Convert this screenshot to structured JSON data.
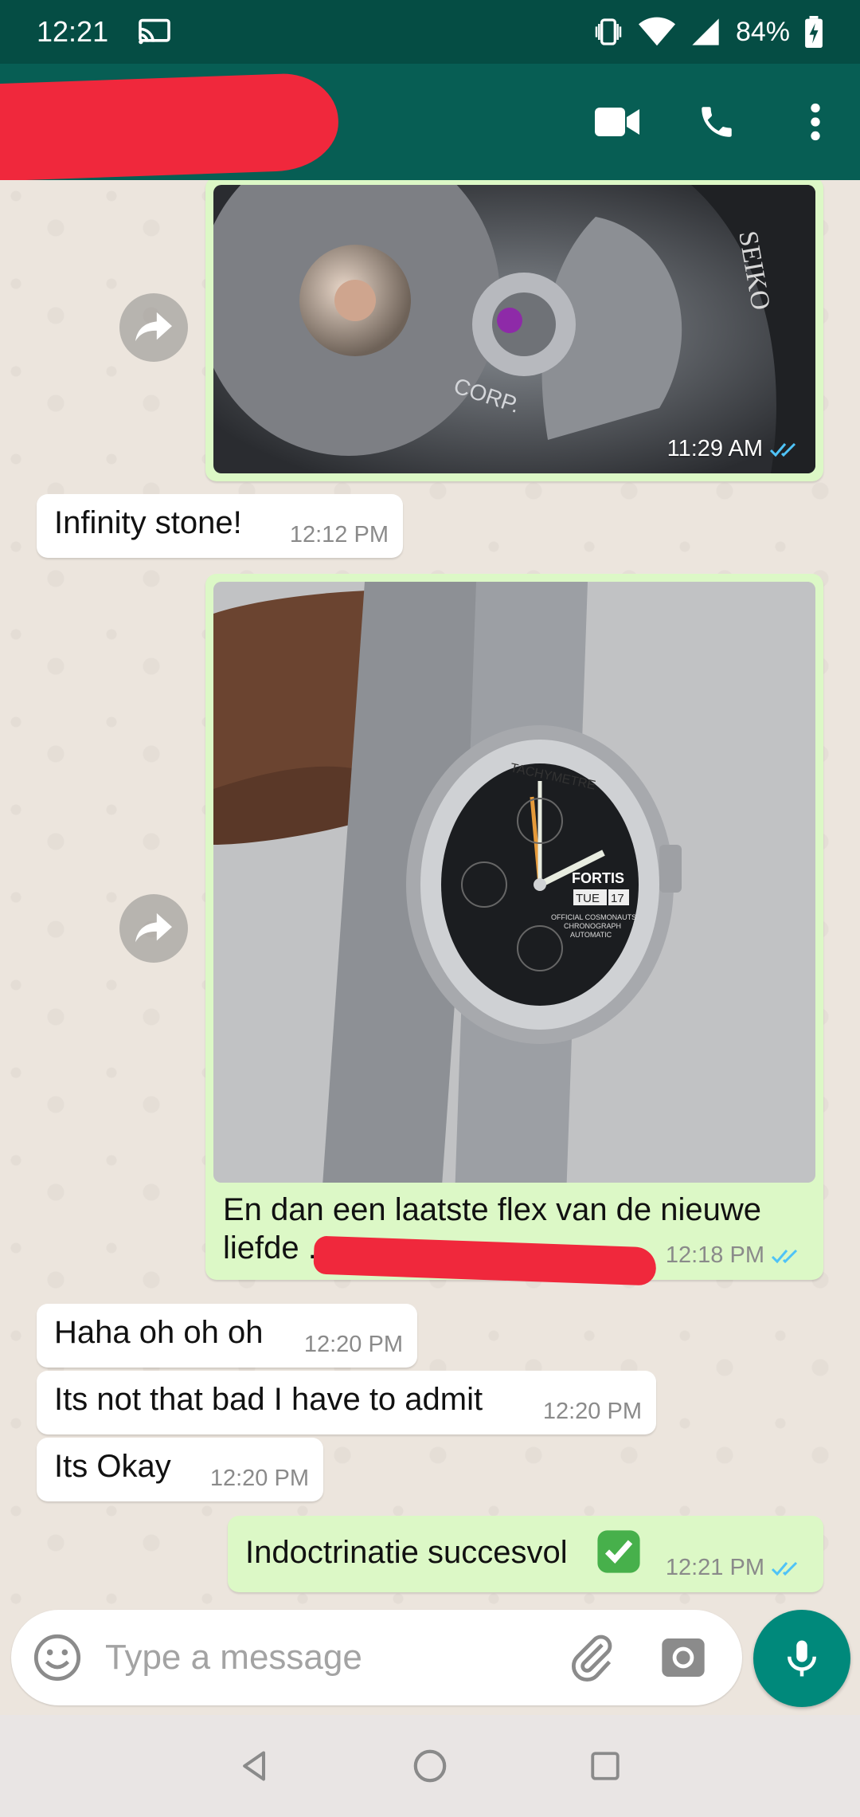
{
  "status_bar": {
    "time": "12:21",
    "battery": "84%"
  },
  "app_bar": {
    "contact_name_redacted": true
  },
  "messages": [
    {
      "type": "image",
      "direction": "out",
      "image_desc": "watch-movement-photo",
      "time": "11:29 AM",
      "status": "read"
    },
    {
      "type": "text",
      "direction": "in",
      "text": "Infinity stone!",
      "time": "12:12 PM"
    },
    {
      "type": "image",
      "direction": "out",
      "image_desc": "fortis-chronograph-watch-photo",
      "caption": "En dan een laatste flex van de nieuwe liefde .",
      "time": "12:18 PM",
      "status": "read"
    },
    {
      "type": "text",
      "direction": "in",
      "text": "Haha oh oh oh",
      "time": "12:20 PM"
    },
    {
      "type": "text",
      "direction": "in",
      "text": "Its not that bad I have to admit",
      "time": "12:20 PM"
    },
    {
      "type": "text",
      "direction": "in",
      "text": "Its Okay",
      "time": "12:20 PM"
    },
    {
      "type": "text",
      "direction": "out",
      "text": "Indoctrinatie succesvol",
      "emoji": "check-mark-button",
      "time": "12:21 PM",
      "status": "read"
    }
  ],
  "photo_watch_text": {
    "brand": "FORTIS",
    "day": "TUE",
    "date": "17",
    "dial_text_1": "OFFICIAL COSMONAUTS",
    "dial_text_2": "CHRONOGRAPH",
    "dial_text_3": "AUTOMATIC",
    "bezel_text": "TACHYMETRE"
  },
  "photo_movement_text": {
    "engraving": "CORP.",
    "brand": "SEIKO"
  },
  "composer": {
    "placeholder": "Type a message"
  },
  "colors": {
    "header": "#075e54",
    "status_bar": "#054d44",
    "outgoing": "#dcf8c6",
    "incoming": "#ffffff",
    "accent": "#00897b",
    "read_ticks": "#4fc3f7"
  }
}
